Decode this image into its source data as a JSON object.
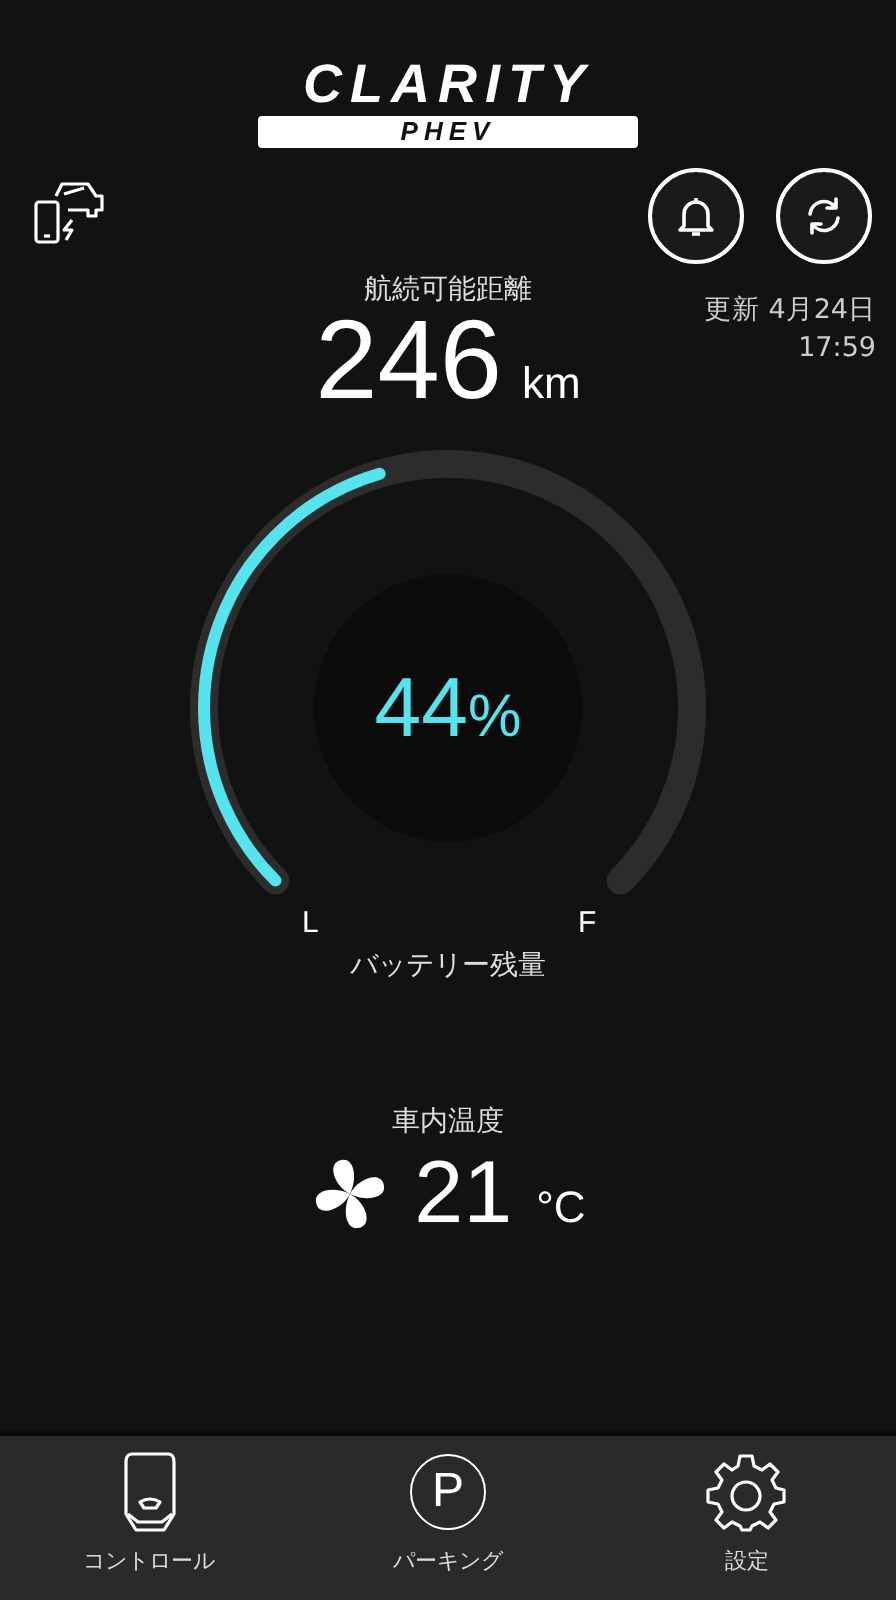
{
  "logo": {
    "title": "CLARITY",
    "badge": "PHEV"
  },
  "range": {
    "label": "航続可能距離",
    "value": "246",
    "unit": "km"
  },
  "updated": {
    "date": "更新 4月24日",
    "time": "17:59"
  },
  "battery": {
    "value": "44",
    "unit": "%",
    "low_label": "L",
    "full_label": "F",
    "label": "バッテリー残量"
  },
  "cabin": {
    "label": "車内温度",
    "value": "21",
    "unit": "°C"
  },
  "tabs": [
    {
      "kind": "control",
      "label": "コントロール"
    },
    {
      "kind": "parking",
      "glyph": "P",
      "label": "パーキング"
    },
    {
      "kind": "settings",
      "label": "設定"
    }
  ]
}
